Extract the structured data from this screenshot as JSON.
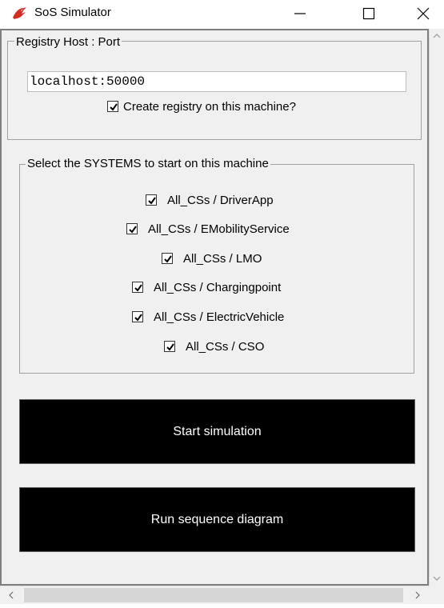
{
  "window": {
    "title": "SoS Simulator",
    "icon": "tk-feather-icon",
    "controls": [
      "minimize-icon",
      "maximize-icon",
      "close-icon"
    ]
  },
  "registry": {
    "group_label": "Registry Host : Port",
    "host_value": "localhost:50000",
    "create_label": "Create registry on this machine?",
    "create_checked": true
  },
  "systems": {
    "group_label": "Select the SYSTEMS to start on this machine",
    "items": [
      {
        "label": "All_CSs / DriverApp",
        "checked": true
      },
      {
        "label": "All_CSs / EMobilityService",
        "checked": true
      },
      {
        "label": "All_CSs / LMO",
        "checked": true
      },
      {
        "label": "All_CSs / Chargingpoint",
        "checked": true
      },
      {
        "label": "All_CSs / ElectricVehicle",
        "checked": true
      },
      {
        "label": "All_CSs / CSO",
        "checked": true
      }
    ]
  },
  "actions": {
    "start_label": "Start simulation",
    "sequence_label": "Run sequence diagram"
  },
  "colors": {
    "button_bg": "#000000",
    "button_fg": "#ffffff",
    "window_bg": "#f0f0f0",
    "icon_red": "#d12f24"
  }
}
